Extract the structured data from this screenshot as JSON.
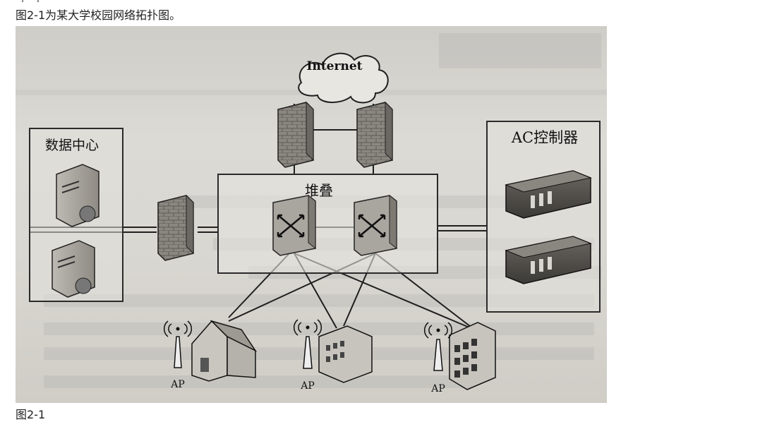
{
  "header_fragment": "【…】",
  "intro_text": "图2-1为某大学校园网络拓扑图。",
  "caption": "图2-1",
  "diagram": {
    "internet_label": "Internet",
    "datacenter_label": "数据中心",
    "stack_label": "堆叠",
    "ac_label": "AC控制器",
    "ap_labels": [
      "AP",
      "AP",
      "AP"
    ]
  }
}
